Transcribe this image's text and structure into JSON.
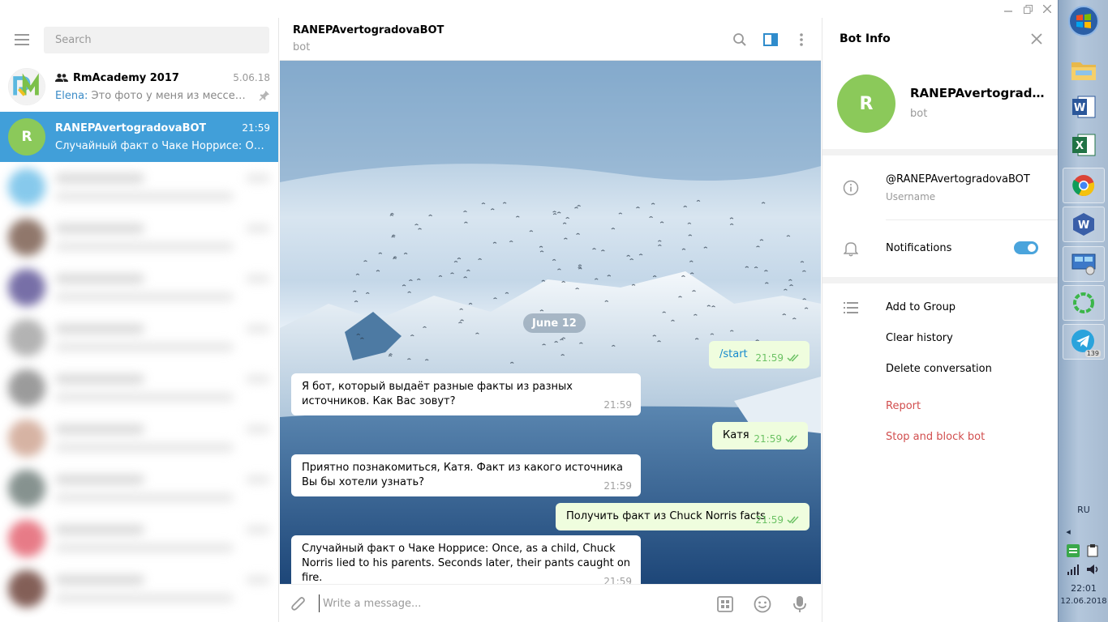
{
  "window": {
    "controls": [
      "minimize-icon",
      "restore-icon",
      "close-icon"
    ]
  },
  "sidebar": {
    "search_placeholder": "Search",
    "chats": [
      {
        "name": "RmAcademy 2017",
        "time": "5.06.18",
        "sender": "Elena:",
        "preview": " Это фото у меня из мессендже...",
        "avatar_color": "#ffffff",
        "type": "group",
        "pinned": true
      },
      {
        "name": "RANEPAvertogradovaBOT",
        "time": "21:59",
        "preview": "Случайный факт о Чаке Норрисе: Once, a...",
        "avatar_letter": "R",
        "avatar_color": "#8bc95a",
        "active": true
      }
    ],
    "blurred_avatar_colors": [
      "#5fb8e6",
      "#6b4a3a",
      "#4a3f8a",
      "#9a9a9a",
      "#7a7a7a",
      "#c99a85",
      "#5e6e6a",
      "#e05060",
      "#5a2a20"
    ]
  },
  "chat": {
    "title": "RANEPAvertogradovaBOT",
    "subtitle": "bot",
    "date_label": "June 12",
    "messages": [
      {
        "dir": "out",
        "text": "/start",
        "time": "21:59",
        "is_command": true
      },
      {
        "dir": "in",
        "text": "Я бот, который выдаёт разные факты из разных источников. Как Вас зовут?",
        "time": "21:59"
      },
      {
        "dir": "out",
        "text": "Катя",
        "time": "21:59"
      },
      {
        "dir": "in",
        "text": "Приятно познакомиться, Катя. Факт из какого источника Вы бы хотели узнать?",
        "time": "21:59"
      },
      {
        "dir": "out",
        "text": "Получить факт из Chuck Norris facts",
        "time": "21:59"
      },
      {
        "dir": "in",
        "text": "Случайный факт о Чаке Норрисе: Once, as a child, Chuck Norris lied to his parents. Seconds later, their pants caught on fire.",
        "time": "21:59"
      }
    ],
    "composer_placeholder": "Write a message..."
  },
  "bot_info": {
    "title": "Bot Info",
    "avatar_letter": "R",
    "name": "RANEPAvertogradovaBOT",
    "subtitle": "bot",
    "username": "@RANEPAvertogradovaBOT",
    "username_hint": "Username",
    "notifications_label": "Notifications",
    "notifications_on": true,
    "actions": [
      "Add to Group",
      "Clear history",
      "Delete conversation"
    ],
    "danger_actions": [
      "Report",
      "Stop and block bot"
    ]
  },
  "taskbar": {
    "apps": [
      "windows-start-icon",
      "file-explorer-icon",
      "word-icon",
      "excel-icon",
      "chrome-icon",
      "wps-icon",
      "remote-desktop-icon",
      "sync-icon",
      "telegram-icon"
    ],
    "telegram_badge": "139",
    "language": "RU",
    "time": "22:01",
    "date": "12.06.2018"
  }
}
